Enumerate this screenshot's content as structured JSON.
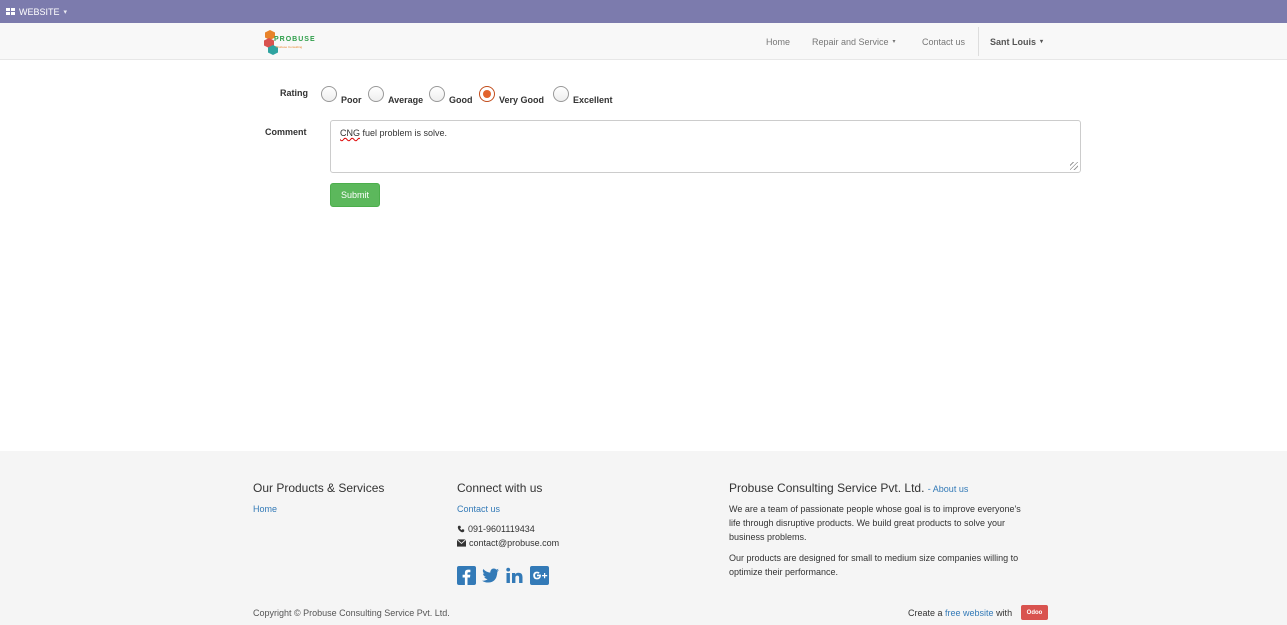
{
  "topbar": {
    "label": "WEBSITE",
    "caret": "▾"
  },
  "navbar": {
    "logo_text": "PROBUSE",
    "logo_sub": "Probuse Consulting",
    "items": [
      {
        "label": "Home"
      },
      {
        "label": "Repair and Service",
        "caret": "▾"
      },
      {
        "label": "Contact us"
      }
    ],
    "user": {
      "label": "Sant Louis",
      "caret": "▾"
    }
  },
  "form": {
    "rating_label": "Rating",
    "rating_options": [
      "Poor",
      "Average",
      "Good",
      "Very Good",
      "Excellent"
    ],
    "rating_selected": "Very Good",
    "comment_label": "Comment",
    "comment_value_misspelled": "CNG",
    "comment_value_rest": " fuel problem is solve.",
    "submit_label": "Submit"
  },
  "footer": {
    "col1": {
      "heading": "Our Products & Services",
      "links": [
        "Home"
      ]
    },
    "col2": {
      "heading": "Connect with us",
      "contact_link": "Contact us",
      "phone": "091-9601119434",
      "email": "contact@probuse.com",
      "social_icons": [
        "facebook-icon",
        "twitter-icon",
        "linkedin-icon",
        "google-plus-icon"
      ]
    },
    "col3": {
      "heading": "Probuse Consulting Service Pvt. Ltd.",
      "about_prefix": "- ",
      "about_link": "About us",
      "para1_lines": [
        "We are a team of passionate people whose goal is to improve everyone's",
        "life through disruptive products. We build great products to solve your",
        "business problems."
      ],
      "para2_lines": [
        "Our products are designed for small to medium size companies willing to",
        "optimize their performance."
      ]
    },
    "copyright": "Copyright © Probuse Consulting Service Pvt. Ltd.",
    "create_prefix": "Create a ",
    "create_link": "free website",
    "create_suffix": " with",
    "odoo_badge": "Odoo"
  },
  "colors": {
    "topbar": "#7c7bad",
    "submit": "#5cb85c",
    "link": "#337ab7",
    "radio_checked": "#e2632c",
    "odoo_badge": "#d9534f"
  }
}
